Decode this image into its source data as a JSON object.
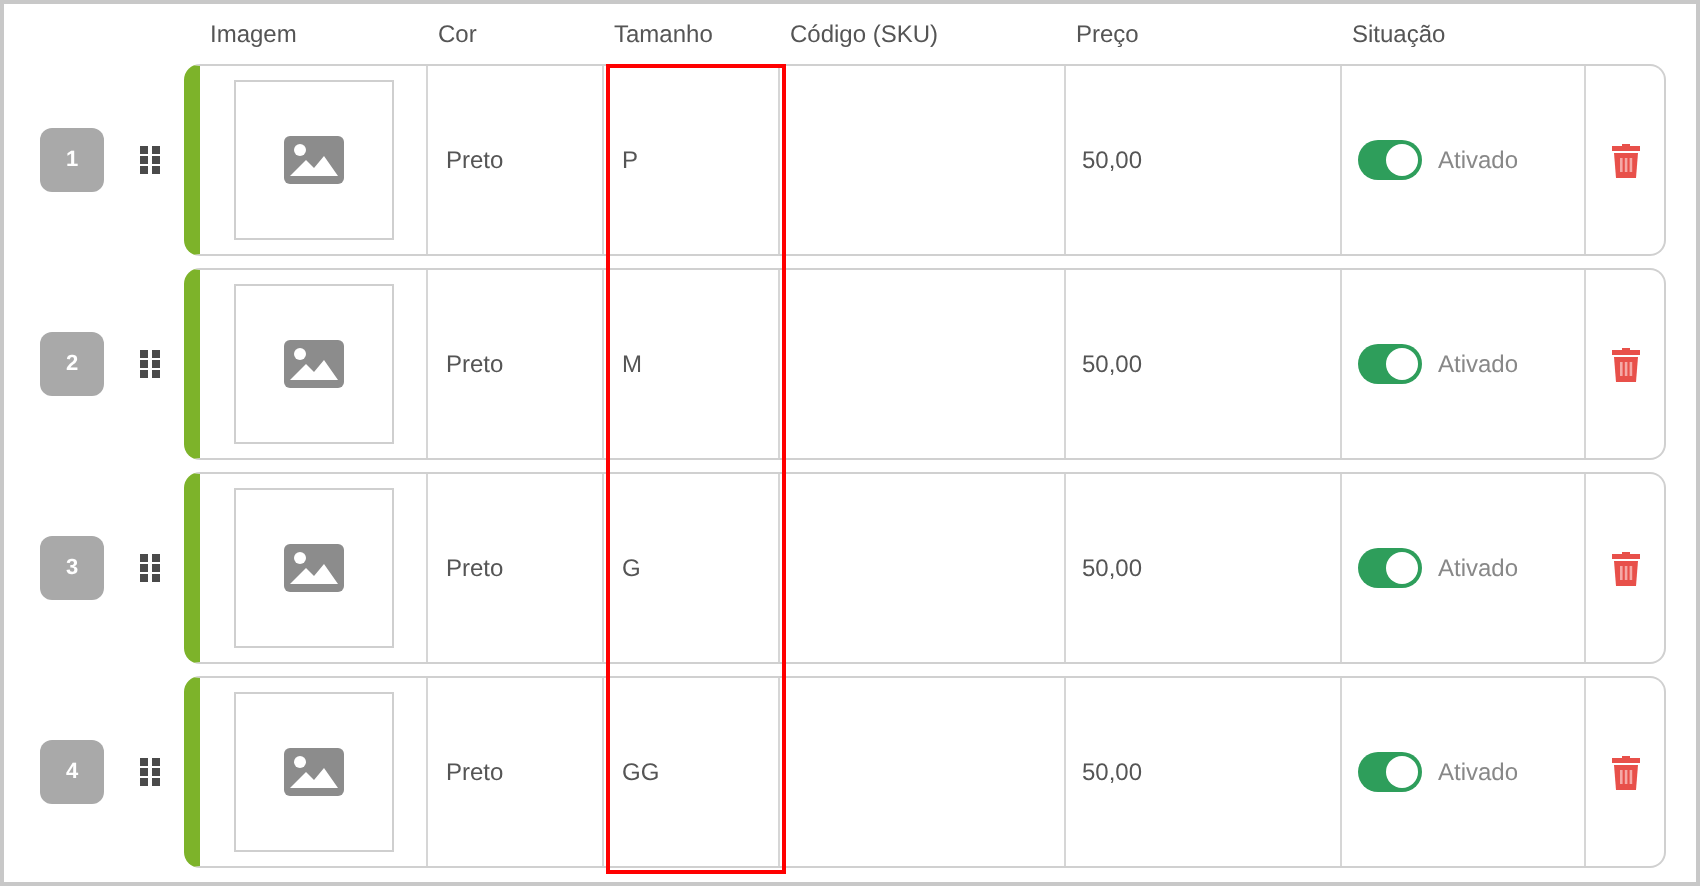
{
  "columns": [
    {
      "label": "Imagem",
      "highlighted": false
    },
    {
      "label": "Cor",
      "highlighted": false
    },
    {
      "label": "Tamanho",
      "highlighted": true
    },
    {
      "label": "Código (SKU)",
      "highlighted": false
    },
    {
      "label": "Preço",
      "highlighted": false
    },
    {
      "label": "Situação",
      "highlighted": false
    }
  ],
  "rows": [
    {
      "number": "1",
      "cor": "Preto",
      "size": "P",
      "price": "50,00",
      "on": true,
      "status": "Ativado"
    },
    {
      "number": "2",
      "cor": "Preto",
      "size": "M",
      "price": "50,00",
      "on": true,
      "status": "Ativado"
    },
    {
      "number": "3",
      "cor": "Preto",
      "size": "G",
      "price": "50,00",
      "on": true,
      "status": "Ativado"
    },
    {
      "number": "4",
      "cor": "Preto",
      "size": "GG",
      "price": "50,00",
      "on": true,
      "status": "Ativado"
    }
  ]
}
